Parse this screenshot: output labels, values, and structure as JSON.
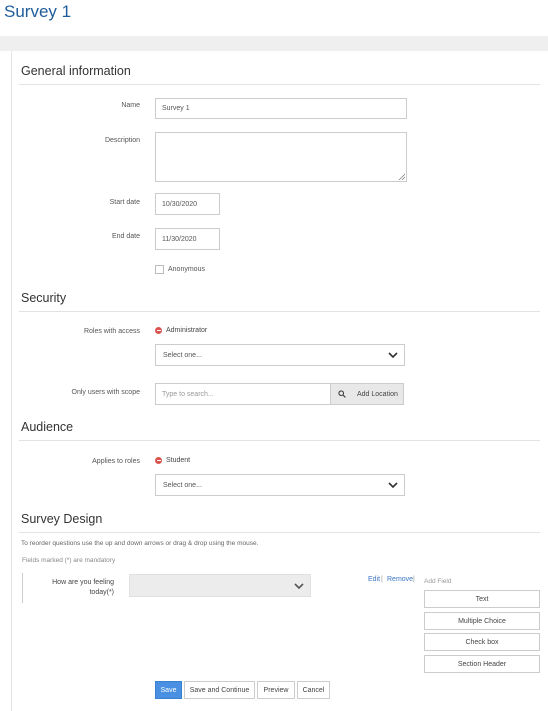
{
  "page": {
    "title": "Survey 1"
  },
  "general": {
    "heading": "General information",
    "name_label": "Name",
    "name_value": "Survey 1",
    "description_label": "Description",
    "description_value": "",
    "start_label": "Start date",
    "start_value": "10/30/2020",
    "end_label": "End date",
    "end_value": "11/30/2020",
    "anonymous_label": "Anonymous",
    "anonymous_checked": false
  },
  "security": {
    "heading": "Security",
    "roles_label": "Roles with access",
    "roles": [
      "Administrator"
    ],
    "roles_select_placeholder": "Select one...",
    "scope_label": "Only users with scope",
    "scope_placeholder": "Type to search...",
    "add_location_label": "Add Location"
  },
  "audience": {
    "heading": "Audience",
    "applies_label": "Applies to roles",
    "roles": [
      "Student"
    ],
    "roles_select_placeholder": "Select one..."
  },
  "design": {
    "heading": "Survey Design",
    "help_text": "To reorder questions use the up and down arrows or drag & drop using the mouse.",
    "mandatory_note": "Fields marked (*) are mandatory",
    "question_label": "How are you feeling today(*)",
    "edit_label": "Edit",
    "remove_label": "Remove",
    "add_field_label": "Add Field",
    "field_types": [
      "Text",
      "Multiple Choice",
      "Check box",
      "Section Header"
    ]
  },
  "actions": {
    "save": "Save",
    "save_continue": "Save and Continue",
    "preview": "Preview",
    "cancel": "Cancel"
  },
  "colors": {
    "accent": "#1f5c99",
    "primary_button": "#4a90e2",
    "remove": "#d9534f",
    "link": "#3a75c4"
  }
}
